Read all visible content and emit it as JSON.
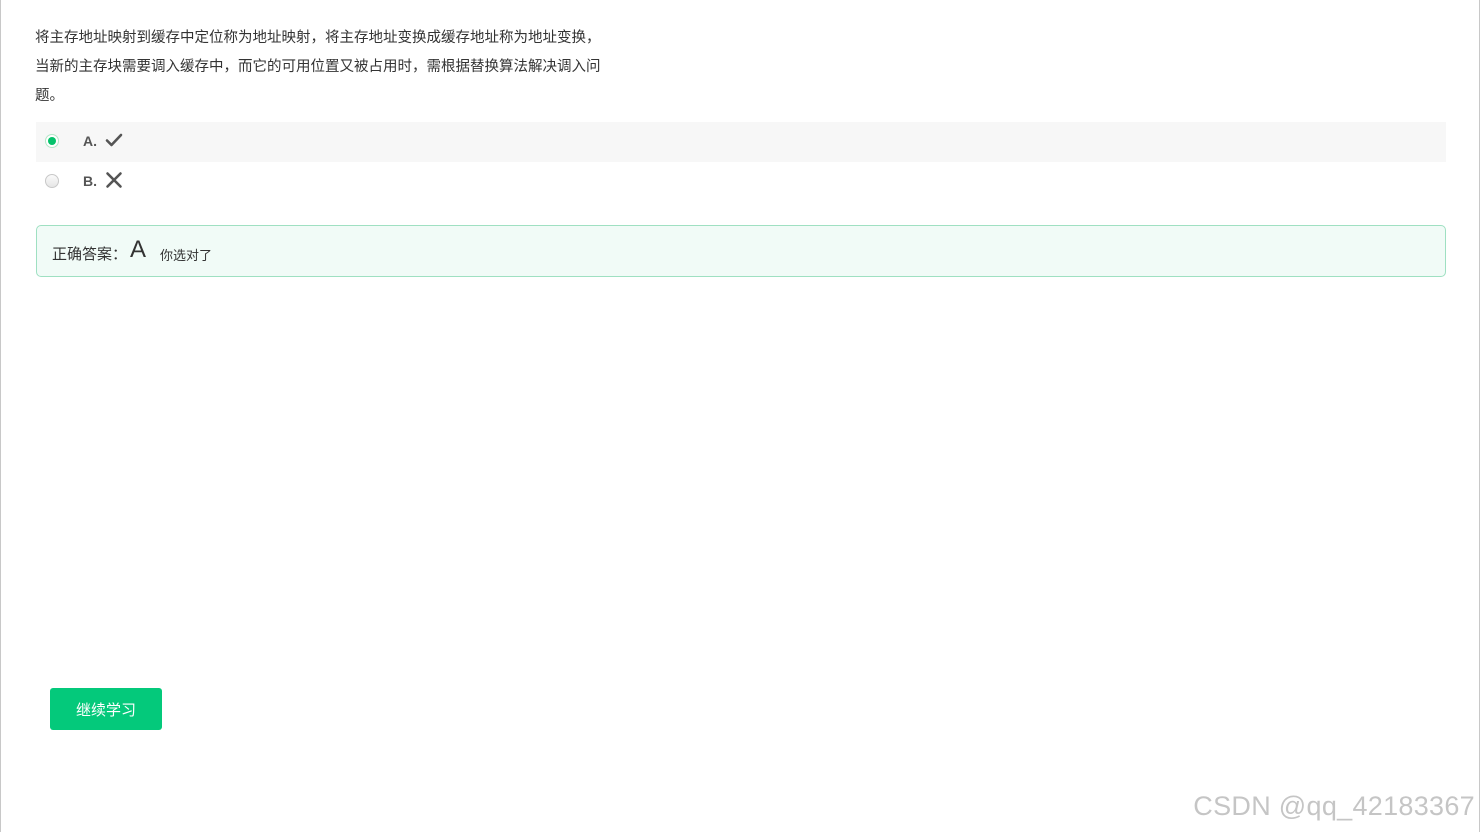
{
  "question": {
    "lines": [
      "将主存地址映射到缓存中定位称为地址映射，将主存地址变换成缓存地址称为地址变换，",
      "当新的主存块需要调入缓存中，而它的可用位置又被占用时，需根据替换算法解决调入问",
      "题。"
    ]
  },
  "options": [
    {
      "letter": "A.",
      "mark": "check-icon",
      "selected": true
    },
    {
      "letter": "B.",
      "mark": "cross-icon",
      "selected": false
    }
  ],
  "answer": {
    "label": "正确答案：",
    "correct_letter": "A",
    "result_text": "你选对了"
  },
  "continue_button": {
    "label": "继续学习"
  },
  "watermark": "CSDN @qq_42183367",
  "colors": {
    "accent_green": "#04c97b",
    "radio_checked": "#05c26b",
    "answer_border": "#9fe0c2",
    "answer_bg": "#f1fbf7",
    "mark_gray": "#555555"
  }
}
